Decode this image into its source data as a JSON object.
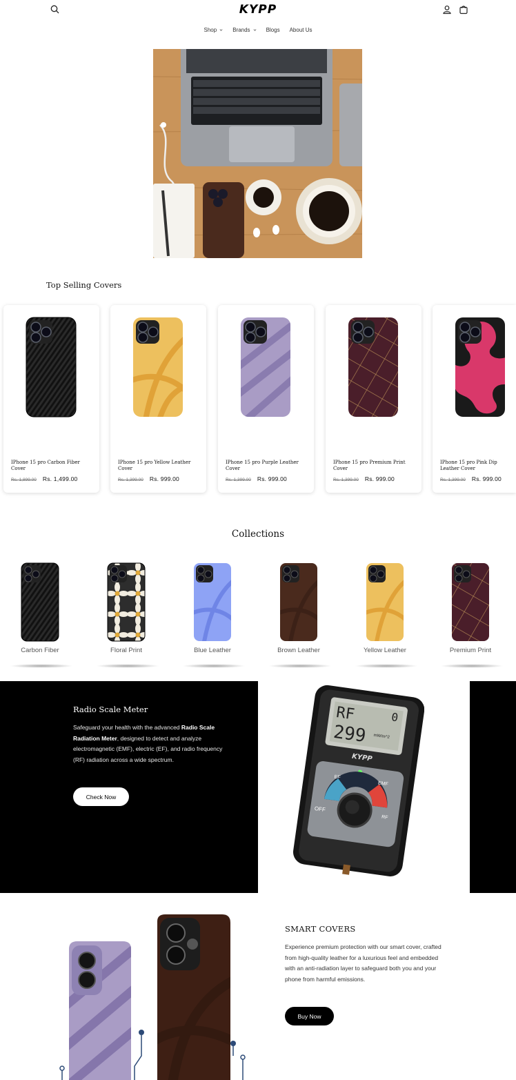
{
  "header": {
    "logo": "KYPP",
    "nav": [
      {
        "label": "Shop",
        "has_dropdown": true
      },
      {
        "label": "Brands",
        "has_dropdown": true
      },
      {
        "label": "Blogs",
        "has_dropdown": false
      },
      {
        "label": "About Us",
        "has_dropdown": false
      }
    ],
    "icons": [
      "search-icon",
      "account-icon",
      "cart-icon"
    ]
  },
  "top_selling": {
    "title": "Top Selling Covers",
    "products": [
      {
        "title": "IPhone 15 pro Carbon Fiber Cover",
        "old_price": "Rs. 1,899.00",
        "price": "Rs. 1,499.00",
        "style": "carbon"
      },
      {
        "title": "IPhone 15 pro Yellow Leather Cover",
        "old_price": "Rs. 1,399.00",
        "price": "Rs. 999.00",
        "style": "yellow"
      },
      {
        "title": "IPhone 15 pro Purple Leather Cover",
        "old_price": "Rs. 1,399.00",
        "price": "Rs. 999.00",
        "style": "purple"
      },
      {
        "title": "IPhone 15 pro Premium Print Cover",
        "old_price": "Rs. 1,399.00",
        "price": "Rs. 999.00",
        "style": "premium"
      },
      {
        "title": "IPhone 15 pro Pink Dip Leather Cover",
        "old_price": "Rs. 1,399.00",
        "price": "Rs. 999.00",
        "style": "pink"
      }
    ]
  },
  "collections": {
    "title": "Collections",
    "items": [
      {
        "label": "Carbon Fiber"
      },
      {
        "label": "Floral Print"
      },
      {
        "label": "Blue Leather"
      },
      {
        "label": "Brown Leather"
      },
      {
        "label": "Yellow Leather"
      },
      {
        "label": "Premium Print"
      }
    ]
  },
  "radio_section": {
    "title": "Radio Scale Meter",
    "desc_before": "Safeguard your health with the advanced ",
    "desc_bold": "Radio Scale Radiation Meter",
    "desc_after": ", designed to detect and analyze electromagnetic (EMF), electric (EF), and radio frequency (RF) radiation across a wide spectrum.",
    "button": "Check Now",
    "meter_display": {
      "mode": "RF",
      "value": "299",
      "unit": "mW/m^2",
      "count": "0",
      "brand": "KYPP"
    },
    "dial_labels": {
      "ef": "EF",
      "emf": "EMF",
      "off": "OFF",
      "rf": "RF"
    }
  },
  "smart_covers": {
    "title": "SMART COVERS",
    "desc": "Experience premium protection with our smart cover, crafted from high-quality leather for a luxurious feel and embedded with an anti-radiation layer to safeguard both you and your phone from harmful emissions.",
    "button": "Buy Now"
  },
  "colors": {
    "black": "#000000",
    "carbon": "#1a1a1a",
    "yellow": "#edc05e",
    "purple": "#a99cc5",
    "premium": "#4b1f2c",
    "pink": "#d9386a",
    "blue": "#8ea3f5",
    "brown": "#4a2a1d"
  }
}
